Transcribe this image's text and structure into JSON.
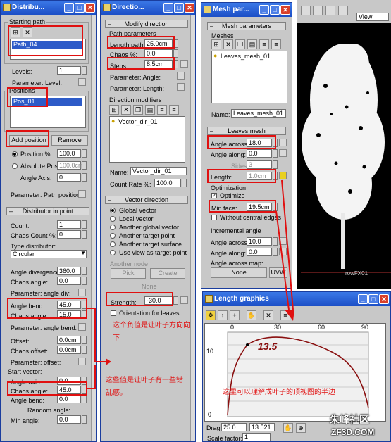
{
  "win1": {
    "title": "Distribu...",
    "starting_path": "Starting path",
    "path_item": "Path_04",
    "levels_label": "Levels:",
    "levels": "1",
    "param_level": "Parameter: Level:",
    "positions": "Positions",
    "pos_item": "Pos_01",
    "add_position": "Add position",
    "remove": "Remove",
    "position_pct": "Position %:",
    "position_pct_val": "100.0",
    "absolute_pos": "Absolute Pos:",
    "absolute_pos_val": "100.0cm",
    "angle_axis": "Angle Axis:",
    "angle_axis_val": "0",
    "param_path_pos": "Parameter: Path position:",
    "rollout": "Distributor in point",
    "count": "Count:",
    "count_val": "1",
    "chaos_count": "Chaos Count %:",
    "chaos_count_val": "0",
    "type_distributor": "Type distributor:",
    "type_val": "Circular",
    "angle_div": "Angle divergence:",
    "angle_div_val": "360.0",
    "chaos_angle": "Chaos angle:",
    "chaos_angle_val": "0.0",
    "param_angle_div": "Parameter: angle div:",
    "angle_bend": "Angle bend:",
    "angle_bend_val": "45.0",
    "chaos_angle2": "Chaos angle:",
    "chaos_angle2_val": "15.0",
    "param_angle_bend": "Parameter: angle bend:",
    "offset": "Offset:",
    "offset_val": "0.0cm",
    "chaos_offset": "Chaos offset:",
    "chaos_offset_val": "0.0cm",
    "param_offset": "Parameter: offset:",
    "start_vector": "Start vector:",
    "angle_axis2": "Angle axis:",
    "angle_axis2_val": "0.0",
    "chaos_angle3": "Chaos angle:",
    "chaos_angle3_val": "45.0",
    "angle_bend2": "Angle bend:",
    "angle_bend2_val": "0.0",
    "random_angle": "Random angle:",
    "min_angle": "Min angle:",
    "min_angle_val": "0.0"
  },
  "win2": {
    "title": "Directio...",
    "rollout1": "Modify direction",
    "path_params": "Path parameters",
    "length_path": "Length path:",
    "length_path_val": "25.0cm",
    "chaos_pct": "Chaos %:",
    "chaos_pct_val": "0.0",
    "steps": "Steps:",
    "steps_val": "8.5cm",
    "param_angle": "Parameter: Angle:",
    "param_length": "Parameter: Length:",
    "dir_modifiers": "Direction modifiers",
    "vec_item": "Vector_dir_01",
    "name_label": "Name:",
    "name_val": "Vector_dir_01",
    "count_rate": "Count Rate %:",
    "count_rate_val": "100.0",
    "rollout2": "Vector direction",
    "opts": [
      "Global vector",
      "Local vector",
      "Another global vector",
      "Another target point",
      "Another target surface",
      "Use view as target point"
    ],
    "another_node": "Another node",
    "pick": "Pick",
    "create": "Create",
    "none": "None",
    "strength": "Strength:",
    "strength_val": "-30.0",
    "orientation": "Orientation for leaves"
  },
  "win3": {
    "title": "Mesh par...",
    "rollout1": "Mesh parameters",
    "meshes": "Meshes",
    "mesh_item": "Leaves_mesh_01",
    "name_label": "Name:",
    "name_val": "Leaves_mesh_01",
    "rollout2": "Leaves mesh",
    "angle_across": "Angle across:",
    "angle_across_val": "18.0",
    "angle_along": "Angle along:",
    "angle_along_val": "0.0",
    "sides": "Sides:",
    "sides_val": "3",
    "length": "Length:",
    "length_val": "1.0cm",
    "optimization": "Optimization",
    "optimize": "Optimize",
    "min_face": "Min face:",
    "min_face_val": "19.5cm",
    "without_edges": "Without central edges",
    "incremental": "Incremental angle",
    "angle_across2": "Angle across:",
    "angle_across2_val": "10.0",
    "angle_along2": "Angle along:",
    "angle_along2_val": "0.0",
    "angle_across_map": "Angle across map:",
    "none_btn": "None",
    "uvw_btn": "UVW"
  },
  "viewport": {
    "view_label": "View",
    "object_label": "rowFX01"
  },
  "graph": {
    "title": "Length graphics",
    "ticks": [
      "0",
      "30",
      "60",
      "90"
    ],
    "y_ticks": [
      "10",
      "0"
    ],
    "drag_label": "Drag",
    "drag_x": "25.0",
    "drag_y": "13.521",
    "scale_label": "Scale factor:",
    "scale_val": "1"
  },
  "annotations": {
    "strength_note": "这个负值是让叶子方向向下",
    "chaos_note": "这些值是让叶子有一些错乱感。",
    "graph_value": "13.5",
    "graph_note": "这里可以理解成叶子的顶视图的半边"
  },
  "watermark": {
    "site": "朱峰社区",
    "url": "ZF3D.COM"
  },
  "colors": {
    "titlebar": "#2a5fd6",
    "annotation": "#e01010",
    "panel": "#c8c8c8"
  }
}
